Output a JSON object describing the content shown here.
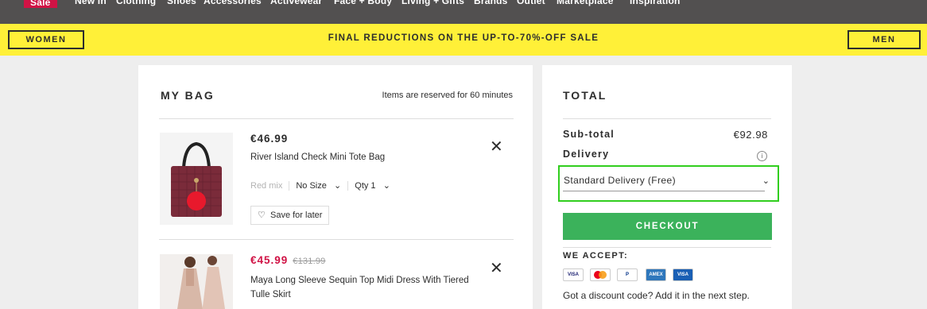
{
  "nav": {
    "items": [
      "Sale",
      "New in",
      "Clothing",
      "Shoes",
      "Accessories",
      "Activewear",
      "Face + Body",
      "Living + Gifts",
      "Brands",
      "Outlet",
      "Marketplace",
      "Inspiration"
    ]
  },
  "promo": {
    "women_label": "WOMEN",
    "text": "FINAL REDUCTIONS ON THE UP-TO-70%-OFF SALE",
    "men_label": "MEN"
  },
  "bag": {
    "title": "MY BAG",
    "reserve_note": "Items are reserved for 60 minutes",
    "items": [
      {
        "price": "€46.99",
        "name": "River Island Check Mini Tote Bag",
        "colour": "Red mix",
        "size": "No Size",
        "qty": "Qty 1",
        "save_label": "Save for later"
      },
      {
        "price": "€45.99",
        "was_price": "€131.99",
        "name": "Maya Long Sleeve Sequin Top Midi Dress With Tiered Tulle Skirt"
      }
    ]
  },
  "total": {
    "title": "TOTAL",
    "subtotal_label": "Sub-total",
    "subtotal_value": "€92.98",
    "delivery_label": "Delivery",
    "delivery_option": "Standard Delivery (Free)",
    "checkout_label": "CHECKOUT",
    "we_accept_label": "WE ACCEPT:",
    "cards": [
      "VISA",
      "Mastercard",
      "PayPal",
      "American Express",
      "VISA"
    ],
    "discount_note": "Got a discount code? Add it in the next step."
  },
  "colors": {
    "promo_bg": "#fff038",
    "nav_bg": "#525050",
    "sale_red": "#d01345",
    "checkout_green": "#3bb25b",
    "highlight_green": "#31ce1e"
  }
}
